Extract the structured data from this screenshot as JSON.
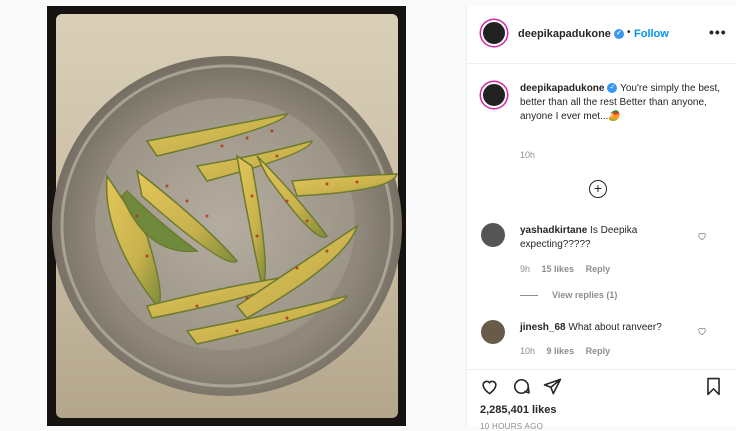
{
  "post": {
    "username": "deepikapadukone",
    "verified_icon": "verified-badge-icon",
    "follow_label": "Follow",
    "more_label": "•••",
    "separator": "•"
  },
  "caption": {
    "username": "deepikapadukone",
    "text": "You're simply the best, better than all the rest Better than anyone, anyone I ever met...🥭",
    "time": "10h"
  },
  "load_more_icon": "plus-circle-icon",
  "comments": [
    {
      "username": "yashadkirtane",
      "text": "Is Deepika expecting?????",
      "time": "9h",
      "likes": "15 likes",
      "reply": "Reply",
      "view_replies": "View replies (1)"
    },
    {
      "username": "jinesh_68",
      "text": "What about ranveer?",
      "time": "10h",
      "likes": "9 likes",
      "reply": "Reply"
    }
  ],
  "actions": {
    "icons": [
      "heart-icon",
      "comment-icon",
      "share-icon",
      "bookmark-icon"
    ],
    "likes": "2,285,401 likes",
    "posted": "10 HOURS AGO"
  },
  "colors": {
    "accent": "#0095f6",
    "muted": "#8e8e8e",
    "text": "#262626"
  }
}
